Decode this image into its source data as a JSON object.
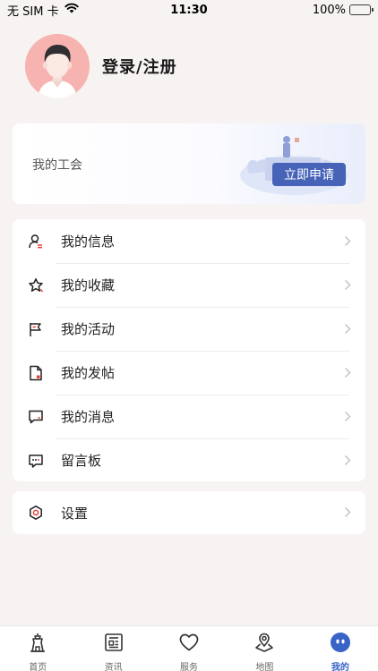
{
  "status_bar": {
    "carrier": "无 SIM 卡",
    "time": "11:30",
    "battery": "100%"
  },
  "profile": {
    "login_label": "登录/注册"
  },
  "union_card": {
    "title": "我的工会",
    "apply_label": "立即申请"
  },
  "menu": {
    "items": [
      {
        "label": "我的信息",
        "icon": "user-info-icon"
      },
      {
        "label": "我的收藏",
        "icon": "star-icon"
      },
      {
        "label": "我的活动",
        "icon": "flag-icon"
      },
      {
        "label": "我的发帖",
        "icon": "document-icon"
      },
      {
        "label": "我的消息",
        "icon": "message-icon"
      },
      {
        "label": "留言板",
        "icon": "comment-icon"
      }
    ],
    "settings_label": "设置"
  },
  "tab_bar": {
    "tabs": [
      {
        "label": "首页",
        "icon": "home-icon"
      },
      {
        "label": "资讯",
        "icon": "news-icon"
      },
      {
        "label": "服务",
        "icon": "heart-icon"
      },
      {
        "label": "地图",
        "icon": "map-pin-icon"
      },
      {
        "label": "我的",
        "icon": "profile-face-icon"
      }
    ],
    "active": "我的"
  },
  "colors": {
    "accent": "#3a63c8",
    "apply_button": "#4663b8",
    "icon_accent": "#e8403a",
    "background": "#f7f3f2"
  }
}
